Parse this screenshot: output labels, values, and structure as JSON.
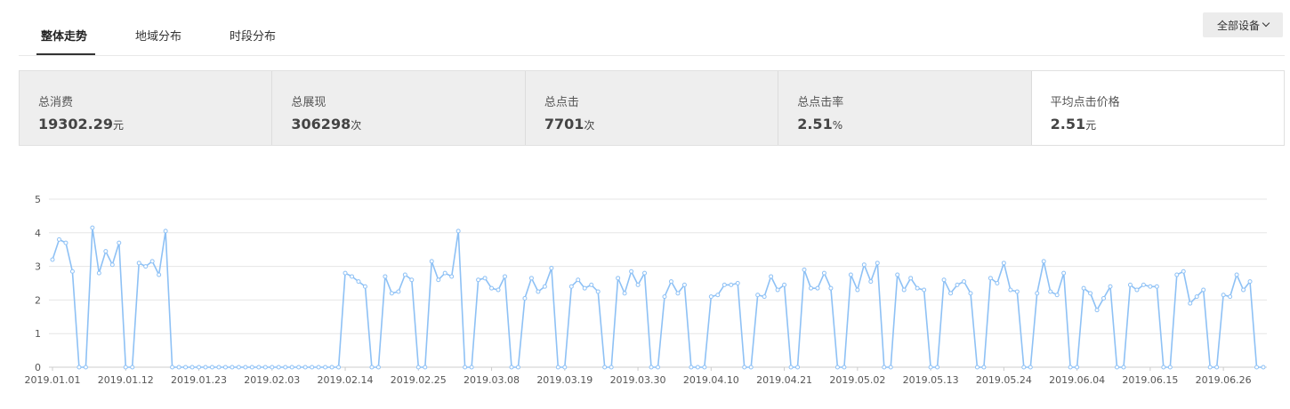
{
  "tabs": [
    "整体走势",
    "地域分布",
    "时段分布"
  ],
  "device_filter": "全部设备",
  "metrics": [
    {
      "label": "总消费",
      "value": "19302.29",
      "unit": "元"
    },
    {
      "label": "总展现",
      "value": "306298",
      "unit": "次"
    },
    {
      "label": "总点击",
      "value": "7701",
      "unit": "次"
    },
    {
      "label": "总点击率",
      "value": "2.51",
      "unit": "%"
    },
    {
      "label": "平均点击价格",
      "value": "2.51",
      "unit": "元"
    }
  ],
  "colors": {
    "line": "#8ec1f5",
    "grid": "#e6e6e6",
    "axis": "#cccccc"
  },
  "chart_data": {
    "type": "line",
    "ylim": [
      0,
      5
    ],
    "yticks": [
      "0",
      "1",
      "2",
      "3",
      "4",
      "5"
    ],
    "grid": true,
    "x_tick_labels": [
      "2019.01.01",
      "2019.01.12",
      "2019.01.23",
      "2019.02.03",
      "2019.02.14",
      "2019.02.25",
      "2019.03.08",
      "2019.03.19",
      "2019.03.30",
      "2019.04.10",
      "2019.04.21",
      "2019.05.02",
      "2019.05.13",
      "2019.05.24",
      "2019.06.04",
      "2019.06.15",
      "2019.06.26"
    ],
    "start_date": "2019.01.01",
    "series": [
      {
        "values": [
          3.2,
          3.8,
          3.7,
          2.85,
          0,
          0,
          4.15,
          2.8,
          3.45,
          3.05,
          3.7,
          0,
          0,
          3.1,
          3.0,
          3.15,
          2.75,
          4.05,
          0,
          0,
          0,
          0,
          0,
          0,
          0,
          0,
          0,
          0,
          0,
          0,
          0,
          0,
          0,
          0,
          0,
          0,
          0,
          0,
          0,
          0,
          0,
          0,
          0,
          0,
          2.8,
          2.7,
          2.55,
          2.4,
          0,
          0,
          2.7,
          2.2,
          2.25,
          2.75,
          2.6,
          0,
          0,
          3.15,
          2.6,
          2.8,
          2.7,
          4.05,
          0,
          0,
          2.6,
          2.65,
          2.35,
          2.3,
          2.7,
          0,
          0,
          2.05,
          2.65,
          2.25,
          2.4,
          2.95,
          0,
          0,
          2.4,
          2.6,
          2.35,
          2.45,
          2.25,
          0,
          0,
          2.65,
          2.2,
          2.85,
          2.45,
          2.8,
          0,
          0,
          2.1,
          2.55,
          2.2,
          2.45,
          0,
          0,
          0,
          2.1,
          2.15,
          2.45,
          2.45,
          2.5,
          0,
          0,
          2.15,
          2.1,
          2.7,
          2.3,
          2.45,
          0,
          0,
          2.9,
          2.35,
          2.35,
          2.8,
          2.35,
          0,
          0,
          2.75,
          2.3,
          3.05,
          2.55,
          3.1,
          0,
          0,
          2.75,
          2.3,
          2.65,
          2.35,
          2.3,
          0,
          0,
          2.6,
          2.2,
          2.45,
          2.55,
          2.2,
          0,
          0,
          2.65,
          2.5,
          3.1,
          2.3,
          2.25,
          0,
          0,
          2.2,
          3.15,
          2.25,
          2.15,
          2.8,
          0,
          0,
          2.35,
          2.2,
          1.7,
          2.05,
          2.4,
          0,
          0,
          2.45,
          2.3,
          2.45,
          2.4,
          2.4,
          0,
          0,
          2.75,
          2.85,
          1.9,
          2.1,
          2.3,
          0,
          0,
          2.15,
          2.1,
          2.75,
          2.3,
          2.55,
          0,
          0
        ]
      }
    ]
  }
}
